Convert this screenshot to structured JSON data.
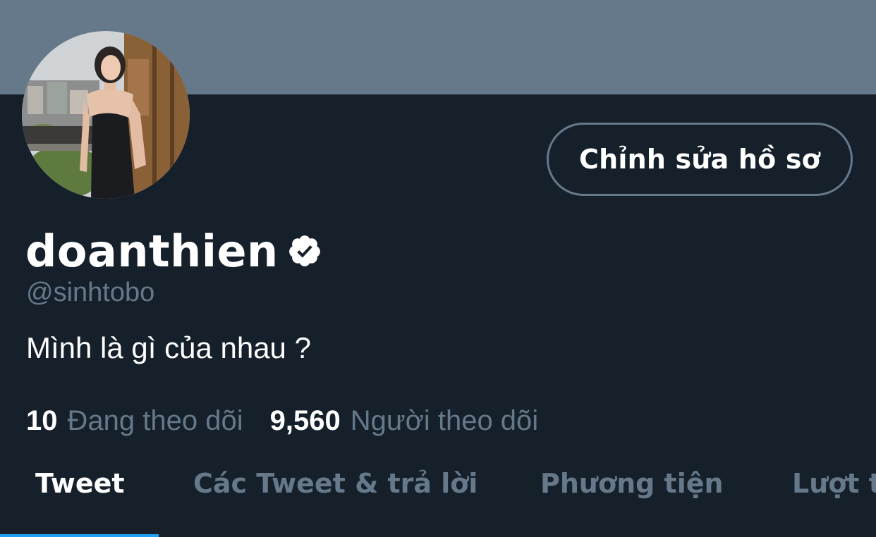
{
  "profile": {
    "display_name": "doanthien",
    "handle": "@sinhtobo",
    "bio": "Mình là gì của nhau ?"
  },
  "actions": {
    "edit_profile_label": "Chỉnh sửa hồ sơ"
  },
  "stats": {
    "following": {
      "count": "10",
      "label": "Đang theo dõi"
    },
    "followers": {
      "count": "9,560",
      "label": "Người theo dõi"
    }
  },
  "tabs": [
    {
      "label": "Tweet",
      "active": true
    },
    {
      "label": "Các Tweet & trả lời",
      "active": false
    },
    {
      "label": "Phương tiện",
      "active": false
    },
    {
      "label": "Lượt thích",
      "active": false
    }
  ],
  "colors": {
    "background": "#15202b",
    "banner": "#66798a",
    "muted_text": "#66798a",
    "accent": "#1da1f2",
    "text": "#ffffff"
  },
  "icons": {
    "verified": "verified-badge-icon"
  }
}
